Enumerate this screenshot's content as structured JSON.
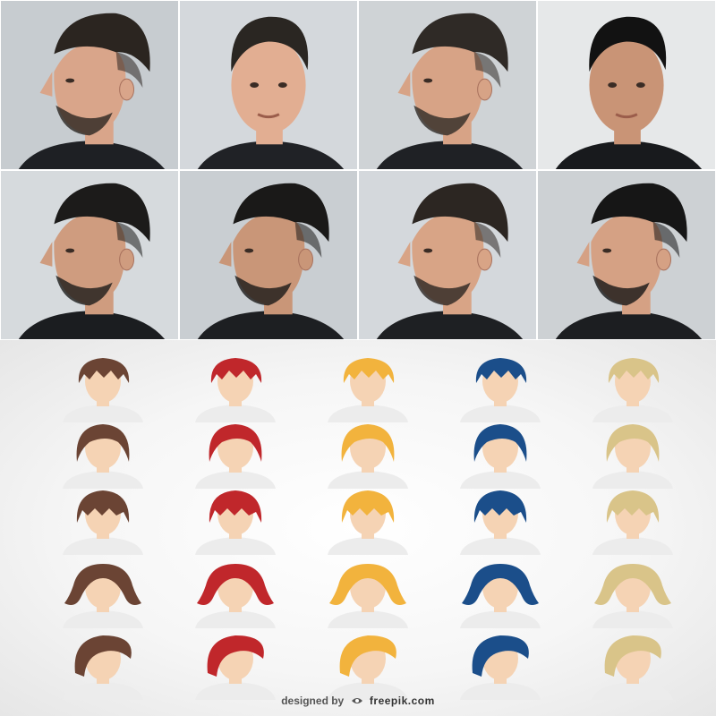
{
  "photos": [
    {
      "skin": "#d9a58a",
      "hair": "#2b2520",
      "bg": "#c7ccd0",
      "cape": "#1e2024",
      "facing": "left"
    },
    {
      "skin": "#e2ae92",
      "hair": "#2a2622",
      "bg": "#d4d8dc",
      "cape": "#202226",
      "facing": "front"
    },
    {
      "skin": "#d7a386",
      "hair": "#2f2a26",
      "bg": "#cfd3d6",
      "cape": "#1f2125",
      "facing": "left"
    },
    {
      "skin": "#c99476",
      "hair": "#121212",
      "bg": "#e6e8e9",
      "cape": "#181a1d",
      "facing": "front"
    },
    {
      "skin": "#cf9c7f",
      "hair": "#1c1b1a",
      "bg": "#d6dadd",
      "cape": "#1b1d20",
      "facing": "left"
    },
    {
      "skin": "#c99678",
      "hair": "#1a1918",
      "bg": "#c9ced2",
      "cape": "#1d1f22",
      "facing": "left"
    },
    {
      "skin": "#d8a486",
      "hair": "#2c2622",
      "bg": "#d4d8dc",
      "cape": "#1e2023",
      "facing": "left"
    },
    {
      "skin": "#d5a184",
      "hair": "#161616",
      "bg": "#cdd1d4",
      "cape": "#1c1e21",
      "facing": "left"
    }
  ],
  "avatar_colors": [
    "brown-hair",
    "red-hair",
    "golden-hair",
    "blue-hair",
    "blonde-hair"
  ],
  "palette": {
    "brown-hair": "#6b4434",
    "red-hair": "#c0272b",
    "golden-hair": "#f2b33d",
    "blue-hair": "#1b4e8a",
    "blonde-hair": "#d9c489",
    "face": "#f5d3b4",
    "shoulder": "#ececec"
  },
  "avatar_styles": [
    "short-messy",
    "side-swept-bob",
    "fringe-bob",
    "wavy-bob",
    "asymmetric-bob"
  ],
  "credit": {
    "prefix": "designed by",
    "brand": "freepik.com"
  }
}
